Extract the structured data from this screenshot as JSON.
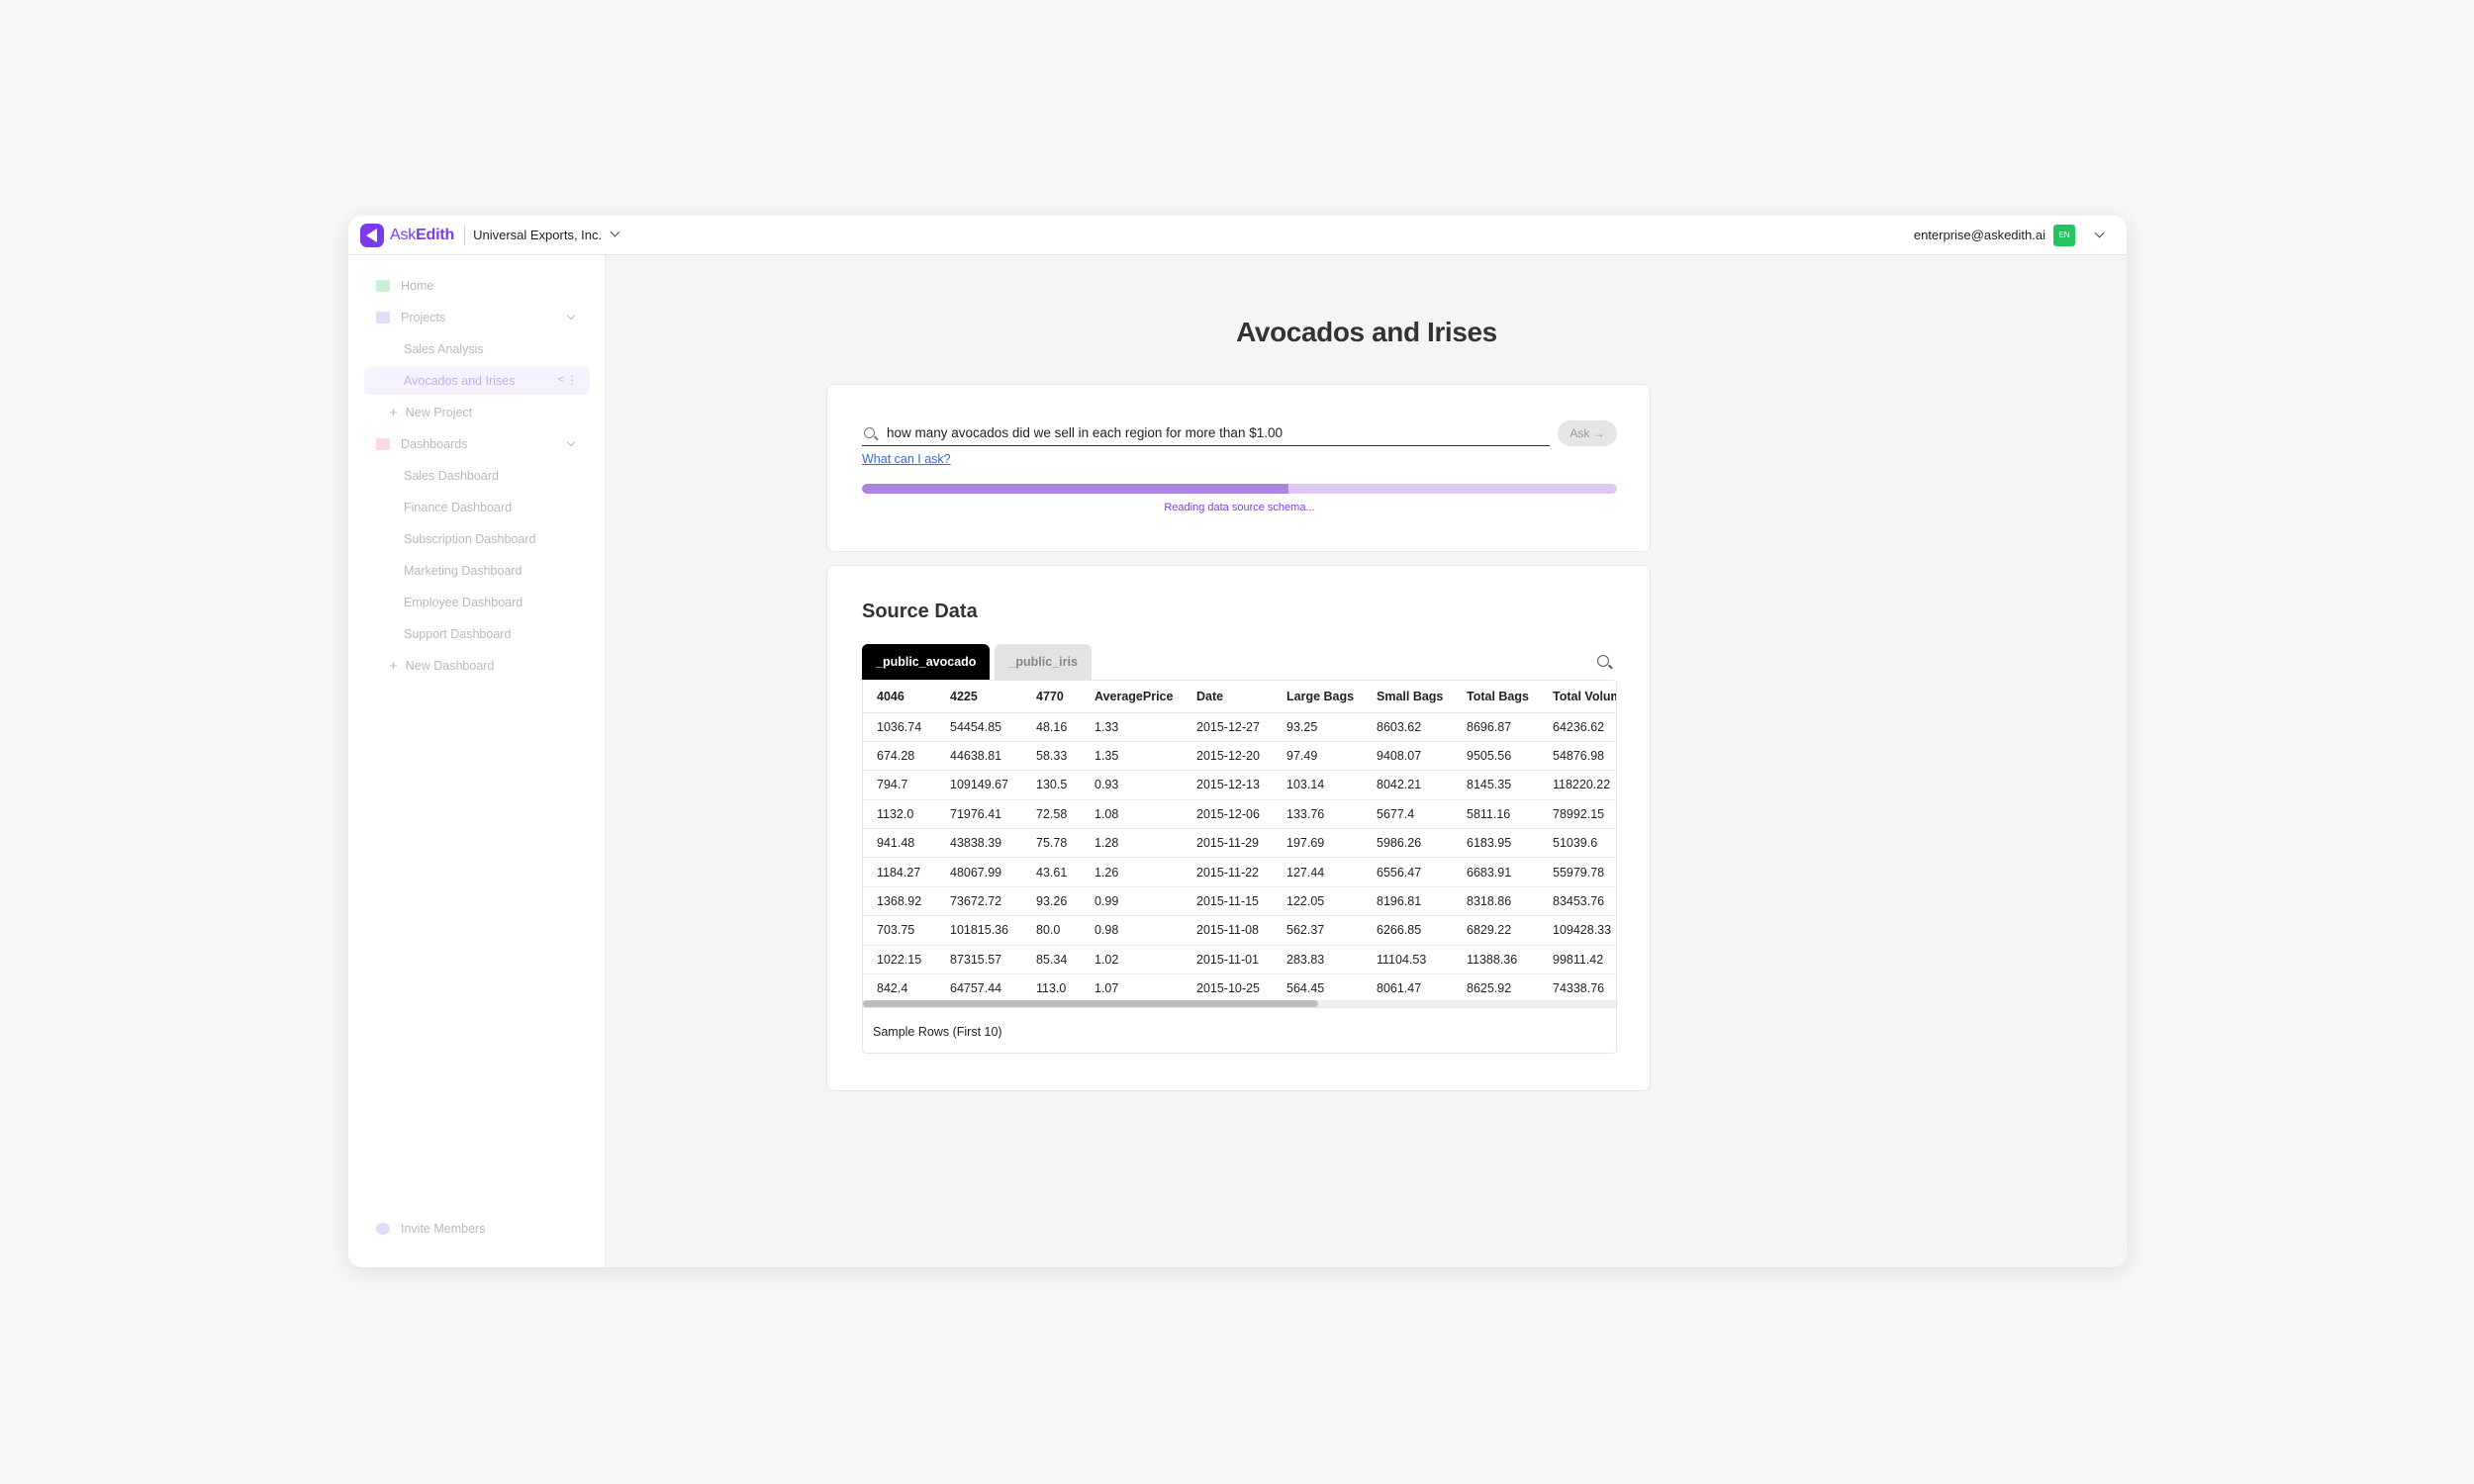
{
  "app": {
    "brand_light": "Ask",
    "brand_bold": "Edith",
    "brand_color": "#7c3aed"
  },
  "topbar": {
    "org_name": "Universal Exports, Inc.",
    "user_email": "enterprise@askedith.ai",
    "language": "EN"
  },
  "sidebar": {
    "home": "Home",
    "projects": "Projects",
    "project_items": [
      "Sales Analysis",
      "Avocados and Irises"
    ],
    "new_project": "New Project",
    "dashboards": "Dashboards",
    "dashboard_items": [
      "Sales Dashboard",
      "Finance Dashboard",
      "Subscription Dashboard",
      "Marketing Dashboard",
      "Employee Dashboard",
      "Support Dashboard"
    ],
    "new_dashboard": "New Dashboard",
    "invite": "Invite Members"
  },
  "main": {
    "title": "Avocados and Irises",
    "query": "how many avocados did we sell in each region for more than $1.00",
    "ask_label": "Ask →",
    "help_link": "What can I ask?",
    "progress": 0.565,
    "status": "Reading data source schema..."
  },
  "source": {
    "title": "Source Data",
    "tabs": [
      "_public_avocado",
      "_public_iris"
    ],
    "columns": [
      "4046",
      "4225",
      "4770",
      "AveragePrice",
      "Date",
      "Large Bags",
      "Small Bags",
      "Total Bags",
      "Total Volume"
    ],
    "rows": [
      [
        "1036.74",
        "54454.85",
        "48.16",
        "1.33",
        "2015-12-27",
        "93.25",
        "8603.62",
        "8696.87",
        "64236.62"
      ],
      [
        "674.28",
        "44638.81",
        "58.33",
        "1.35",
        "2015-12-20",
        "97.49",
        "9408.07",
        "9505.56",
        "54876.98"
      ],
      [
        "794.7",
        "109149.67",
        "130.5",
        "0.93",
        "2015-12-13",
        "103.14",
        "8042.21",
        "8145.35",
        "118220.22"
      ],
      [
        "1132.0",
        "71976.41",
        "72.58",
        "1.08",
        "2015-12-06",
        "133.76",
        "5677.4",
        "5811.16",
        "78992.15"
      ],
      [
        "941.48",
        "43838.39",
        "75.78",
        "1.28",
        "2015-11-29",
        "197.69",
        "5986.26",
        "6183.95",
        "51039.6"
      ],
      [
        "1184.27",
        "48067.99",
        "43.61",
        "1.26",
        "2015-11-22",
        "127.44",
        "6556.47",
        "6683.91",
        "55979.78"
      ],
      [
        "1368.92",
        "73672.72",
        "93.26",
        "0.99",
        "2015-11-15",
        "122.05",
        "8196.81",
        "8318.86",
        "83453.76"
      ],
      [
        "703.75",
        "101815.36",
        "80.0",
        "0.98",
        "2015-11-08",
        "562.37",
        "6266.85",
        "6829.22",
        "109428.33"
      ],
      [
        "1022.15",
        "87315.57",
        "85.34",
        "1.02",
        "2015-11-01",
        "283.83",
        "11104.53",
        "11388.36",
        "99811.42"
      ],
      [
        "842.4",
        "64757.44",
        "113.0",
        "1.07",
        "2015-10-25",
        "564.45",
        "8061.47",
        "8625.92",
        "74338.76"
      ]
    ],
    "footer": "Sample Rows (First 10)"
  }
}
